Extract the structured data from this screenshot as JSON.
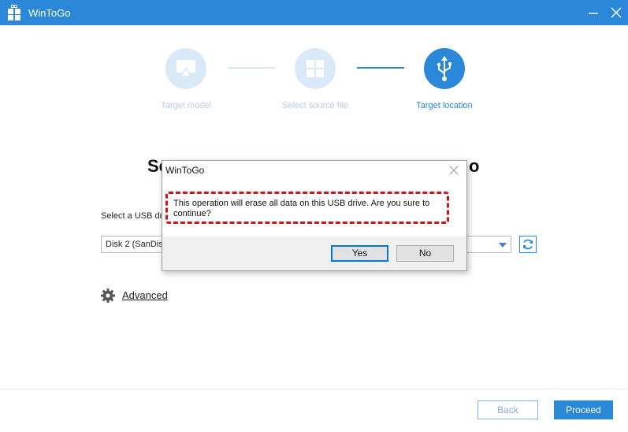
{
  "window": {
    "title": "WinToGo"
  },
  "steps": [
    {
      "label": "Target model",
      "icon": "monitor-icon",
      "state": "done"
    },
    {
      "label": "Select source file",
      "icon": "windows-logo-icon",
      "state": "done"
    },
    {
      "label": "Target location",
      "icon": "usb-icon",
      "state": "active"
    }
  ],
  "main": {
    "heading_left": "Se",
    "heading_right": "o",
    "usb_label": "Select a USB dri",
    "usb_select_value": "Disk 2 (SanDisk",
    "advanced_label": "Advanced"
  },
  "footer": {
    "back_label": "Back",
    "proceed_label": "Proceed"
  },
  "dialog": {
    "title": "WinToGo",
    "message": "This operation will erase all data on this USB drive. Are you sure to continue?",
    "yes_label": "Yes",
    "no_label": "No"
  },
  "colors": {
    "accent": "#2b88d9",
    "step_inactive": "#d9e9f7",
    "highlight_border": "#d0131c"
  }
}
